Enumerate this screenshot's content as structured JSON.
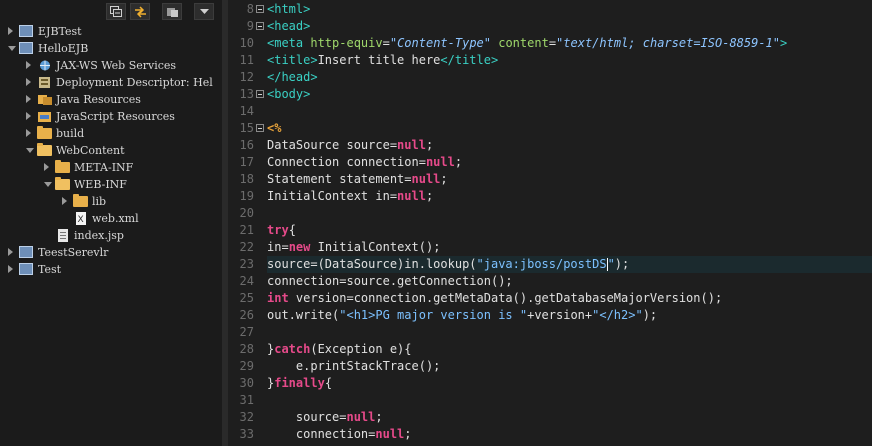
{
  "explorer": {
    "toolbar": [
      {
        "name": "collapse-all-button",
        "icon": "collapse-all-icon"
      },
      {
        "name": "link-with-editor-button",
        "icon": "link-with-editor-icon"
      },
      {
        "name": "view-menu-button",
        "icon": "view-menu-icon"
      },
      {
        "name": "dropdown-button",
        "icon": "chevron-down-icon"
      }
    ],
    "items": [
      {
        "label": "EJBTest",
        "indent": 0,
        "arrow": "right",
        "icon": "project"
      },
      {
        "label": "HelloEJB",
        "indent": 0,
        "arrow": "down",
        "icon": "project"
      },
      {
        "label": "JAX-WS Web Services",
        "indent": 1,
        "arrow": "right",
        "icon": "webservice"
      },
      {
        "label": "Deployment Descriptor: Hel",
        "indent": 1,
        "arrow": "right",
        "icon": "descriptor"
      },
      {
        "label": "Java Resources",
        "indent": 1,
        "arrow": "right",
        "icon": "package"
      },
      {
        "label": "JavaScript Resources",
        "indent": 1,
        "arrow": "right",
        "icon": "jsres"
      },
      {
        "label": "build",
        "indent": 1,
        "arrow": "right",
        "icon": "folder"
      },
      {
        "label": "WebContent",
        "indent": 1,
        "arrow": "down",
        "icon": "folder-open"
      },
      {
        "label": "META-INF",
        "indent": 2,
        "arrow": "right",
        "icon": "folder"
      },
      {
        "label": "WEB-INF",
        "indent": 2,
        "arrow": "down",
        "icon": "folder-open"
      },
      {
        "label": "lib",
        "indent": 3,
        "arrow": "right",
        "icon": "folder"
      },
      {
        "label": "web.xml",
        "indent": 3,
        "arrow": "none",
        "icon": "xml-file"
      },
      {
        "label": "index.jsp",
        "indent": 2,
        "arrow": "none",
        "icon": "jsp-file"
      },
      {
        "label": "TeestSerevlr",
        "indent": 0,
        "arrow": "right",
        "icon": "project"
      },
      {
        "label": "Test",
        "indent": 0,
        "arrow": "right",
        "icon": "project"
      }
    ]
  },
  "editor": {
    "lines": [
      {
        "n": "8",
        "fold": true,
        "html": "<span class=\"tag\">&lt;html&gt;</span>"
      },
      {
        "n": "9",
        "fold": true,
        "html": "<span class=\"tag\">&lt;head&gt;</span>"
      },
      {
        "n": "10",
        "html": "<span class=\"tag\">&lt;meta</span> <span class=\"attr\">http-equiv</span>=<span class=\"str\">\"Content-Type\"</span> <span class=\"attr\">content</span>=<span class=\"str\">\"text/html; charset=ISO-8859-1\"</span><span class=\"tag\">&gt;</span>"
      },
      {
        "n": "11",
        "html": "<span class=\"tag\">&lt;title&gt;</span>Insert title here<span class=\"tag\">&lt;/title&gt;</span>"
      },
      {
        "n": "12",
        "html": "<span class=\"tag\">&lt;/head&gt;</span>"
      },
      {
        "n": "13",
        "fold": true,
        "html": "<span class=\"tag\">&lt;body&gt;</span>"
      },
      {
        "n": "14",
        "html": ""
      },
      {
        "n": "15",
        "fold": true,
        "html": "<span class=\"kw\" style=\"color:#e8a33a\">&lt;%</span>"
      },
      {
        "n": "16",
        "html": "DataSource source=<span class=\"kw\">null</span>;"
      },
      {
        "n": "17",
        "html": "Connection connection=<span class=\"kw\">null</span>;"
      },
      {
        "n": "18",
        "html": "Statement statement=<span class=\"kw\">null</span>;"
      },
      {
        "n": "19",
        "html": "InitialContext in=<span class=\"kw\">null</span>;"
      },
      {
        "n": "20",
        "html": ""
      },
      {
        "n": "21",
        "html": "<span class=\"kw\">try</span>{"
      },
      {
        "n": "22",
        "html": "in=<span class=\"kw\">new</span> InitialContext();"
      },
      {
        "n": "23",
        "current": true,
        "html": "source=(DataSource)in.lookup(<span class=\"jstr\">\"java:jboss/postDS</span><span class=\"caret\"></span><span class=\"jstr\">\"</span>);"
      },
      {
        "n": "24",
        "html": "connection=source.getConnection();"
      },
      {
        "n": "25",
        "html": "<span class=\"kw\">int</span> version=connection.getMetaData().getDatabaseMajorVersion();"
      },
      {
        "n": "26",
        "html": "out.write(<span class=\"jstr\">\"&lt;h1&gt;PG major version is \"</span>+version+<span class=\"jstr\">\"&lt;/h2&gt;\"</span>);"
      },
      {
        "n": "27",
        "html": ""
      },
      {
        "n": "28",
        "html": "}<span class=\"kw\">catch</span>(Exception e){"
      },
      {
        "n": "29",
        "html": "    e.printStackTrace();"
      },
      {
        "n": "30",
        "html": "}<span class=\"kw\">finally</span>{"
      },
      {
        "n": "31",
        "html": ""
      },
      {
        "n": "32",
        "html": "    source=<span class=\"kw\">null</span>;"
      },
      {
        "n": "33",
        "html": "    connection=<span class=\"kw\">null</span>;"
      }
    ]
  }
}
